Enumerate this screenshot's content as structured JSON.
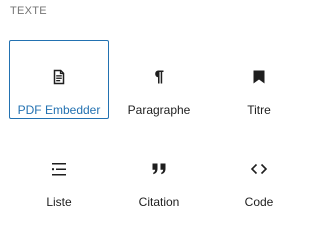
{
  "section": {
    "title": "TEXTE"
  },
  "blocks": [
    {
      "label": "PDF Embedder",
      "icon": "document-icon",
      "selected": true
    },
    {
      "label": "Paragraphe",
      "icon": "paragraph-icon",
      "selected": false
    },
    {
      "label": "Titre",
      "icon": "bookmark-icon",
      "selected": false
    },
    {
      "label": "Liste",
      "icon": "list-icon",
      "selected": false
    },
    {
      "label": "Citation",
      "icon": "quote-icon",
      "selected": false
    },
    {
      "label": "Code",
      "icon": "code-icon",
      "selected": false
    }
  ],
  "colors": {
    "accent": "#2271b1",
    "text": "#1e1e1e",
    "muted": "#757575"
  }
}
